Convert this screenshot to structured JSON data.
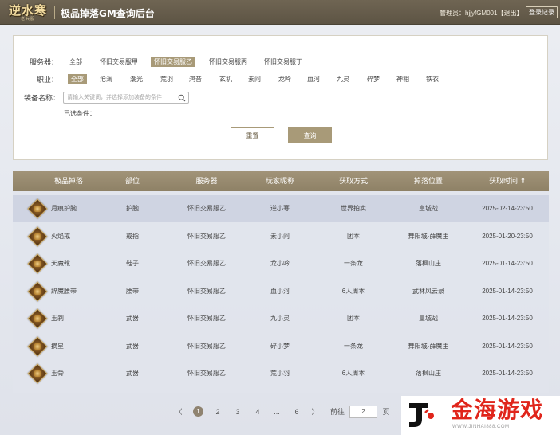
{
  "header": {
    "logo_text": "逆水寒",
    "logo_sub": "老兵服",
    "title": "极品掉落GM查询后台",
    "admin_text": "管理员：hjjyfGM001【退出】",
    "logout_button": "登录记录"
  },
  "filters": {
    "server_label": "服务器：",
    "servers": [
      "全部",
      "怀旧交易服甲",
      "怀旧交易服乙",
      "怀旧交易服丙",
      "怀旧交易服丁"
    ],
    "server_selected": "怀旧交易服乙",
    "class_label": "职业：",
    "classes": [
      "全部",
      "沧澜",
      "潮光",
      "荒羽",
      "鸿音",
      "玄机",
      "素问",
      "龙吟",
      "血河",
      "九灵",
      "碎梦",
      "神相",
      "铁衣"
    ],
    "class_selected": "全部",
    "equip_label": "装备名称：",
    "equip_placeholder": "请输入关键词，并选择添加装备的条件",
    "selected_conditions_label": "已选条件：",
    "reset_button": "重置",
    "query_button": "查询"
  },
  "table": {
    "columns": [
      "极品掉落",
      "部位",
      "服务器",
      "玩家昵称",
      "获取方式",
      "掉落位置",
      "获取时间 ⇕"
    ],
    "rows": [
      {
        "item": "月痕护腕",
        "slot": "护腕",
        "server": "怀旧交易服乙",
        "player": "逆小寒",
        "method": "世界拍卖",
        "location": "皇城战",
        "time": "2025-02-14-23:50"
      },
      {
        "item": "火焰戒",
        "slot": "戒指",
        "server": "怀旧交易服乙",
        "player": "素小问",
        "method": "团本",
        "location": "舞阳城-薛魔主",
        "time": "2025-01-20-23:50"
      },
      {
        "item": "天魔靴",
        "slot": "鞋子",
        "server": "怀旧交易服乙",
        "player": "龙小吟",
        "method": "一条龙",
        "location": "落枫山庄",
        "time": "2025-01-14-23:50"
      },
      {
        "item": "辞魔腰带",
        "slot": "腰带",
        "server": "怀旧交易服乙",
        "player": "血小河",
        "method": "6人周本",
        "location": "武林风云录",
        "time": "2025-01-14-23:50"
      },
      {
        "item": "玉刹",
        "slot": "武器",
        "server": "怀旧交易服乙",
        "player": "九小灵",
        "method": "团本",
        "location": "皇城战",
        "time": "2025-01-14-23:50"
      },
      {
        "item": "摘星",
        "slot": "武器",
        "server": "怀旧交易服乙",
        "player": "碎小梦",
        "method": "一条龙",
        "location": "舞阳城-薛魔主",
        "time": "2025-01-14-23:50"
      },
      {
        "item": "玉骨",
        "slot": "武器",
        "server": "怀旧交易服乙",
        "player": "荒小羽",
        "method": "6人周本",
        "location": "落枫山庄",
        "time": "2025-01-14-23:50"
      }
    ],
    "highlighted_row": 0
  },
  "pagination": {
    "prev": "〈",
    "pages": [
      "1",
      "2",
      "3",
      "4",
      "...",
      "6"
    ],
    "current": "1",
    "next": "〉",
    "goto_label": "前往",
    "goto_value": "2",
    "page_unit": "页"
  },
  "watermark": {
    "text": "金海游戏",
    "url": "WWW.JINHAI888.COM"
  },
  "colors": {
    "header_bg": "#6a604e",
    "accent": "#a89a78",
    "table_header": "#998c72",
    "highlight_row": "#cfd4e2",
    "watermark_red": "#e0251b"
  }
}
